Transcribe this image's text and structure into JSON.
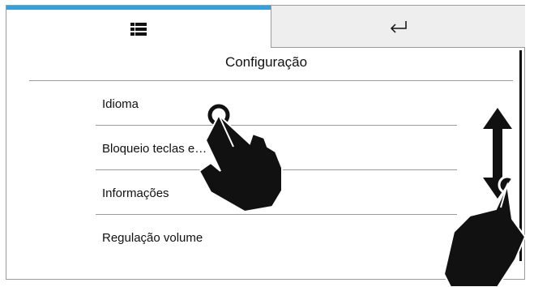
{
  "tabs": {
    "menu_icon": "list-icon",
    "back_icon": "return-arrow-icon"
  },
  "header": {
    "title": "Configuração"
  },
  "menu": {
    "items": [
      {
        "label": "Idioma"
      },
      {
        "label": "Bloqueio teclas e…"
      },
      {
        "label": "Informações"
      },
      {
        "label": "Regulação volume"
      }
    ]
  },
  "colors": {
    "active_tab": "#2ea3e3",
    "inactive_tab": "#eeeeee",
    "divider": "#9a9a9a"
  }
}
